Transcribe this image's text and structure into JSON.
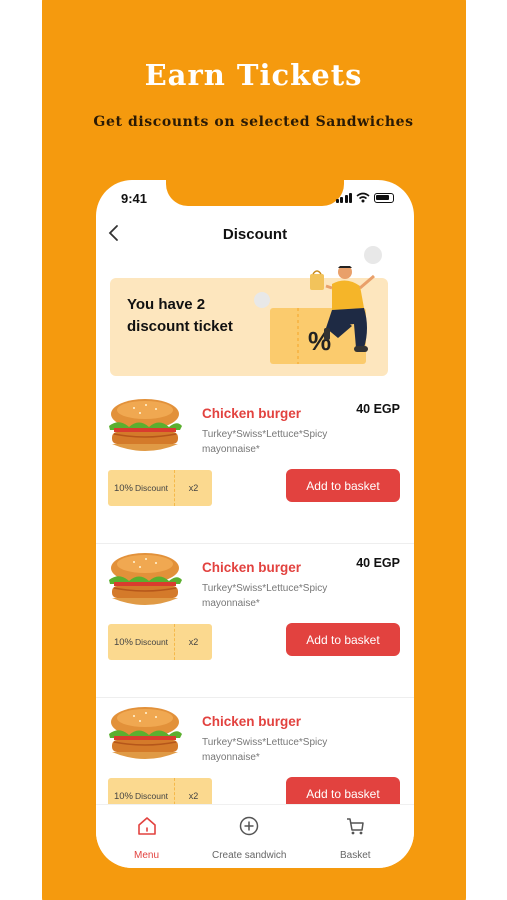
{
  "promo": {
    "title": "Earn Tickets",
    "subtitle": "Get discounts on selected Sandwiches"
  },
  "status_bar": {
    "time": "9:41"
  },
  "header": {
    "back_icon": "chevron-left-icon",
    "title": "Discount"
  },
  "banner": {
    "text": "You have 2 discount ticket",
    "illustration_symbol": "%"
  },
  "products": [
    {
      "name": "Chicken burger",
      "price": "40 EGP",
      "description": "Turkey*Swiss*Lettuce*Spicy mayonnaise*",
      "ticket_percent": "10%",
      "ticket_label": "Discount",
      "ticket_qty": "x2",
      "button_label": "Add to basket"
    },
    {
      "name": "Chicken burger",
      "price": "40 EGP",
      "description": "Turkey*Swiss*Lettuce*Spicy mayonnaise*",
      "ticket_percent": "10%",
      "ticket_label": "Discount",
      "ticket_qty": "x2",
      "button_label": "Add to basket"
    },
    {
      "name": "Chicken burger",
      "price": "",
      "description": "Turkey*Swiss*Lettuce*Spicy mayonnaise*",
      "ticket_percent": "10%",
      "ticket_label": "Discount",
      "ticket_qty": "x2",
      "button_label": "Add to basket"
    }
  ],
  "bottom_nav": [
    {
      "label": "Menu",
      "icon": "home-icon",
      "active": true
    },
    {
      "label": "Create sandwich",
      "icon": "plus-circle-icon",
      "active": false
    },
    {
      "label": "Basket",
      "icon": "basket-icon",
      "active": false
    }
  ],
  "colors": {
    "background_orange": "#F59A0E",
    "accent_red": "#E2423F",
    "banner_bg": "#FDE6BE",
    "ticket_bg": "#FBD98F"
  }
}
